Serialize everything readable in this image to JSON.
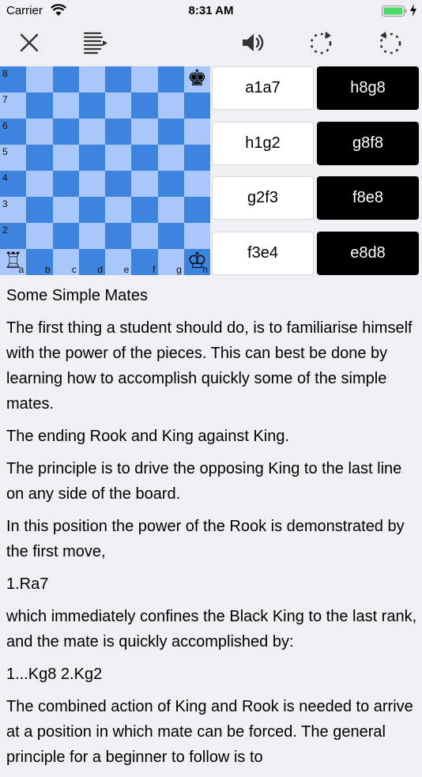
{
  "status": {
    "carrier": "Carrier",
    "time": "8:31 AM"
  },
  "toolbar": {
    "close_icon": "close-icon",
    "menu_icon": "list-menu-icon",
    "sound_icon": "speaker-icon",
    "redo_icon": "rotate-clockwise-icon",
    "undo_icon": "rotate-counterclockwise-icon"
  },
  "board": {
    "ranks": [
      "8",
      "7",
      "6",
      "5",
      "4",
      "3",
      "2"
    ],
    "files": [
      "a",
      "b",
      "c",
      "d",
      "e",
      "f",
      "g",
      "h"
    ],
    "pieces": {
      "black_king": "♚",
      "white_rook": "♖",
      "white_king": "♔"
    },
    "light_color": "#a9c7fb",
    "dark_color": "#3c84de"
  },
  "moves": [
    {
      "white": "a1a7",
      "black": "h8g8"
    },
    {
      "white": "h1g2",
      "black": "g8f8"
    },
    {
      "white": "g2f3",
      "black": "f8e8"
    },
    {
      "white": "f3e4",
      "black": "e8d8"
    }
  ],
  "text": {
    "title": "Some Simple Mates",
    "p1": "The first thing a student should do, is to familiarise himself with the power of the pieces. This can best be done by learning how to accomplish quickly some of the simple mates.",
    "p2": "The ending Rook and King against King.",
    "p3": "The principle is to drive the opposing King to the last line on any side of the board.",
    "p4": "In this position the power of the Rook is demonstrated by the first move,",
    "p5": "1.Ra7",
    "p6": "which immediately confines the Black King to the last rank, and the mate is quickly accomplished by:",
    "p7": "1...Kg8 2.Kg2",
    "p8": "The combined action of King and Rook is needed to arrive at a position in which mate can be forced. The general principle for a beginner to follow is to"
  }
}
